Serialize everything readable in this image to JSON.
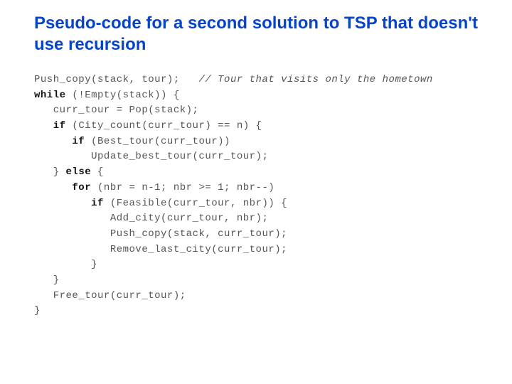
{
  "title": "Pseudo-code for a second solution to TSP that doesn't use recursion",
  "code": {
    "l1a": "Push_copy(stack, tour);   ",
    "l1c": "// Tour that visits only the hometown",
    "l2k": "while",
    "l2a": " (!Empty(stack)) {",
    "l3": "   curr_tour = Pop(stack);",
    "l4k": "   if",
    "l4a": " (City_count(curr_tour) == n) {",
    "l5k": "      if",
    "l5a": " (Best_tour(curr_tour))",
    "l6": "         Update_best_tour(curr_tour);",
    "l7a": "   } ",
    "l7k": "else",
    "l7b": " {",
    "l8k": "      for",
    "l8a": " (nbr = n-1; nbr >= 1; nbr--)",
    "l9k": "         if",
    "l9a": " (Feasible(curr_tour, nbr)) {",
    "l10": "            Add_city(curr_tour, nbr);",
    "l11": "            Push_copy(stack, curr_tour);",
    "l12": "            Remove_last_city(curr_tour);",
    "l13": "         }",
    "l14": "   }",
    "l15": "   Free_tour(curr_tour);",
    "l16": "}"
  }
}
